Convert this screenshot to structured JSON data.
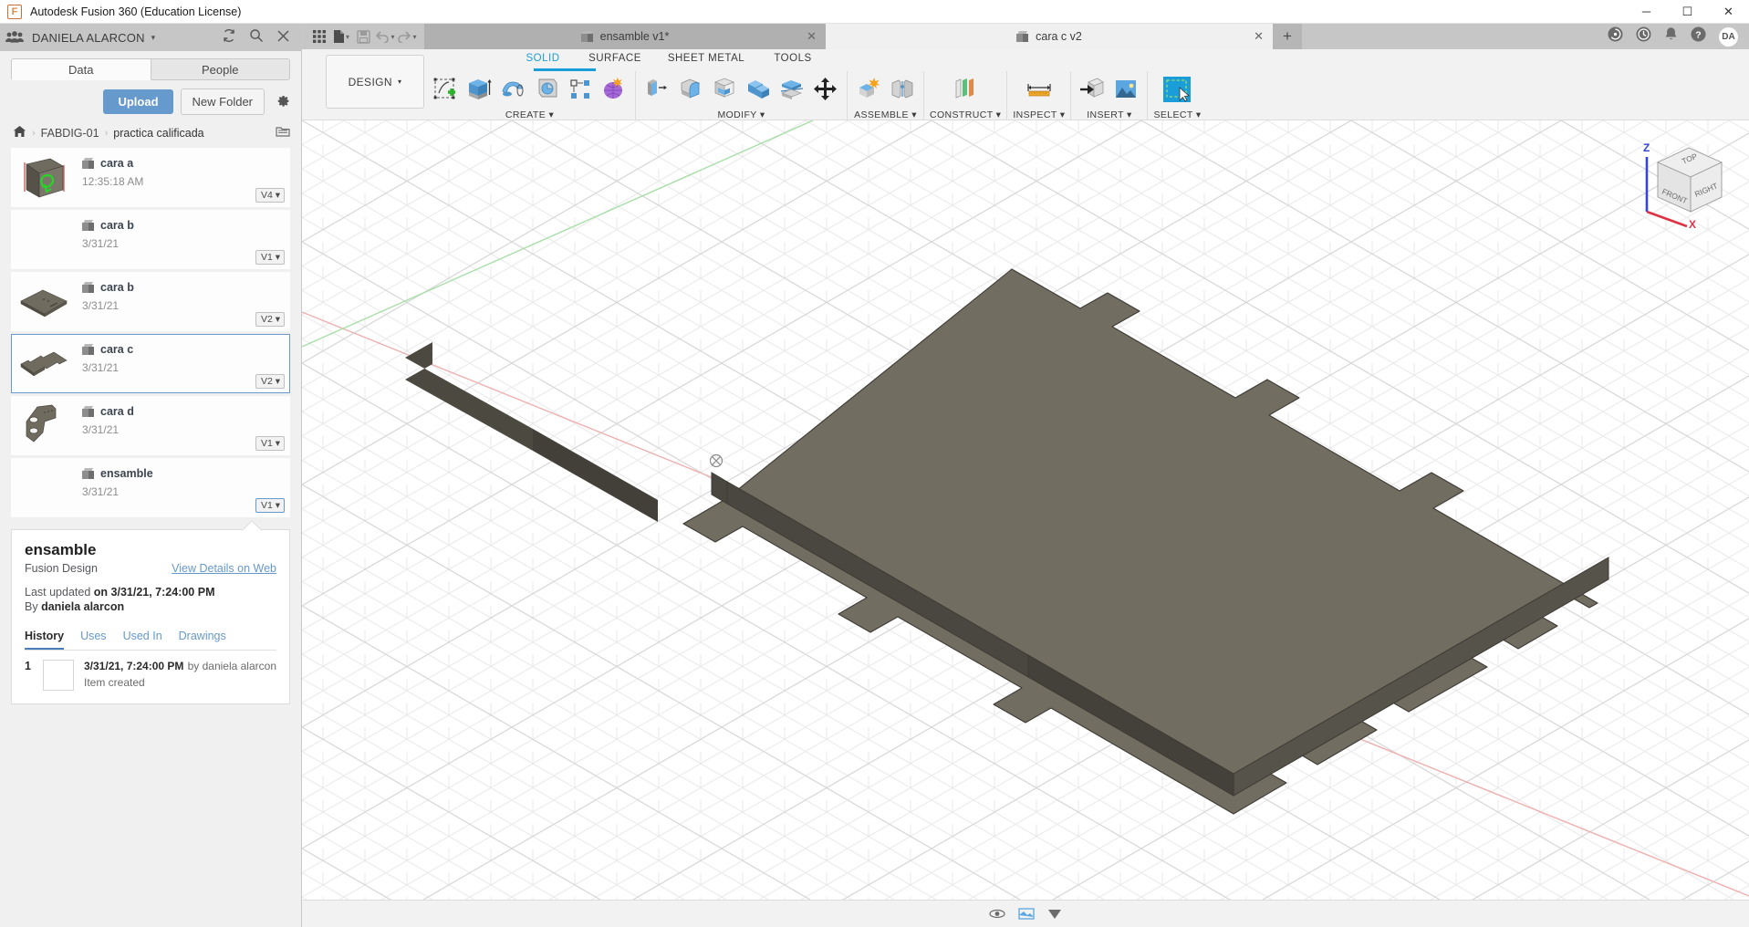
{
  "window": {
    "title": "Autodesk Fusion 360 (Education License)",
    "logo_letter": "F",
    "minimize": "─",
    "maximize": "☐",
    "close": "✕"
  },
  "sidebar": {
    "user": "DANIELA ALARCON",
    "user_caret": "▾",
    "refresh_icon": "↻",
    "search_icon": "⌕",
    "close_icon": "✕",
    "tabs": [
      {
        "label": "Data",
        "active": true
      },
      {
        "label": "People",
        "active": false
      }
    ],
    "actions": {
      "upload": "Upload",
      "new_folder": "New Folder",
      "settings_icon": "⚙"
    },
    "breadcrumb": {
      "home_icon": "⌂",
      "items": [
        "FABDIG-01",
        "practica calificada"
      ],
      "separator": "›",
      "folder_icon": "⌘"
    },
    "files": [
      {
        "name": "cara a",
        "date": "12:35:18 AM",
        "version": "V4",
        "selected": false,
        "has_thumb": true,
        "thumb": "cara-a"
      },
      {
        "name": "cara b",
        "date": "3/31/21",
        "version": "V1",
        "selected": false,
        "has_thumb": false,
        "thumb": ""
      },
      {
        "name": "cara b",
        "date": "3/31/21",
        "version": "V2",
        "selected": false,
        "has_thumb": true,
        "thumb": "plate"
      },
      {
        "name": "cara c",
        "date": "3/31/21",
        "version": "V2",
        "selected": true,
        "has_thumb": true,
        "thumb": "plate"
      },
      {
        "name": "cara d",
        "date": "3/31/21",
        "version": "V1",
        "selected": false,
        "has_thumb": true,
        "thumb": "bracket"
      },
      {
        "name": "ensamble",
        "date": "3/31/21",
        "version": "V1",
        "selected": false,
        "has_thumb": false,
        "thumb": ""
      }
    ],
    "details": {
      "title": "ensamble",
      "type": "Fusion Design",
      "link": "View Details on Web",
      "updated_label": "Last updated",
      "updated_value": "on 3/31/21, 7:24:00 PM",
      "by_label": "By",
      "by_value": "daniela alarcon",
      "tabs": [
        {
          "label": "History",
          "active": true
        },
        {
          "label": "Uses",
          "active": false
        },
        {
          "label": "Used In",
          "active": false
        },
        {
          "label": "Drawings",
          "active": false
        }
      ],
      "history": [
        {
          "num": "1",
          "date": "3/31/21, 7:24:00 PM",
          "by": "by daniela alarcon",
          "action": "Item created"
        }
      ]
    }
  },
  "tabstrip": {
    "quick_tools": [
      {
        "name": "app-grid",
        "glyph": "☷"
      },
      {
        "name": "new-file",
        "glyph": "▤",
        "caret": "▾"
      },
      {
        "name": "save",
        "glyph": "⬚"
      },
      {
        "name": "undo",
        "glyph": "↶",
        "caret": "▾"
      },
      {
        "name": "redo",
        "glyph": "↷",
        "caret": "▾"
      }
    ],
    "docs": [
      {
        "label": "ensamble v1*",
        "active": false,
        "close": "✕"
      },
      {
        "label": "cara c v2",
        "active": true,
        "close": "✕"
      }
    ],
    "add_tab": "+",
    "right_icons": [
      {
        "name": "job-status-icon"
      },
      {
        "name": "recent-activity-icon"
      },
      {
        "name": "notifications-icon"
      },
      {
        "name": "help-icon"
      }
    ],
    "avatar_initials": "DA"
  },
  "ribbon": {
    "workspace": "DESIGN",
    "workspace_caret": "▾",
    "tabs": [
      {
        "label": "SOLID",
        "active": true
      },
      {
        "label": "SURFACE",
        "active": false
      },
      {
        "label": "SHEET METAL",
        "active": false
      },
      {
        "label": "TOOLS",
        "active": false
      }
    ],
    "groups": [
      {
        "label": "CREATE",
        "caret": "▾",
        "tools": [
          "create-sketch-icon",
          "extrude-icon",
          "revolve-icon",
          "sweep-icon",
          "pattern-icon",
          "form-icon"
        ]
      },
      {
        "label": "MODIFY",
        "caret": "▾",
        "tools": [
          "press-pull-icon",
          "fillet-icon",
          "shell-icon",
          "combine-icon",
          "split-face-icon",
          "move-copy-icon"
        ]
      },
      {
        "label": "ASSEMBLE",
        "caret": "▾",
        "tools": [
          "new-component-icon",
          "joint-icon"
        ]
      },
      {
        "label": "CONSTRUCT",
        "caret": "▾",
        "tools": [
          "offset-plane-icon"
        ]
      },
      {
        "label": "INSPECT",
        "caret": "▾",
        "tools": [
          "measure-icon"
        ]
      },
      {
        "label": "INSERT",
        "caret": "▾",
        "tools": [
          "insert-derive-icon",
          "insert-canvas-icon"
        ]
      },
      {
        "label": "SELECT",
        "caret": "▾",
        "tools": [
          "select-window-icon"
        ]
      }
    ]
  },
  "canvas": {
    "viewcube": {
      "faces": [
        "TOP",
        "FRONT",
        "RIGHT"
      ],
      "axes": [
        {
          "label": "Z",
          "color": "#3344dd"
        },
        {
          "label": "X",
          "color": "#dd3344"
        }
      ]
    },
    "model": {
      "name": "cara c",
      "body_color": "#6f6b5f",
      "edge_color": "#3a3a36",
      "side_color": "#4a4740"
    },
    "grid": {
      "minor_color": "#e8e8e8",
      "major_color": "#d4d4d4",
      "x_axis_color": "#e08b8b",
      "y_axis_color": "#8fd08f"
    }
  },
  "colors": {
    "accent": "#6699cc",
    "ribbon_active": "#1a9ed9",
    "titlebar": "#c6c6c6"
  }
}
